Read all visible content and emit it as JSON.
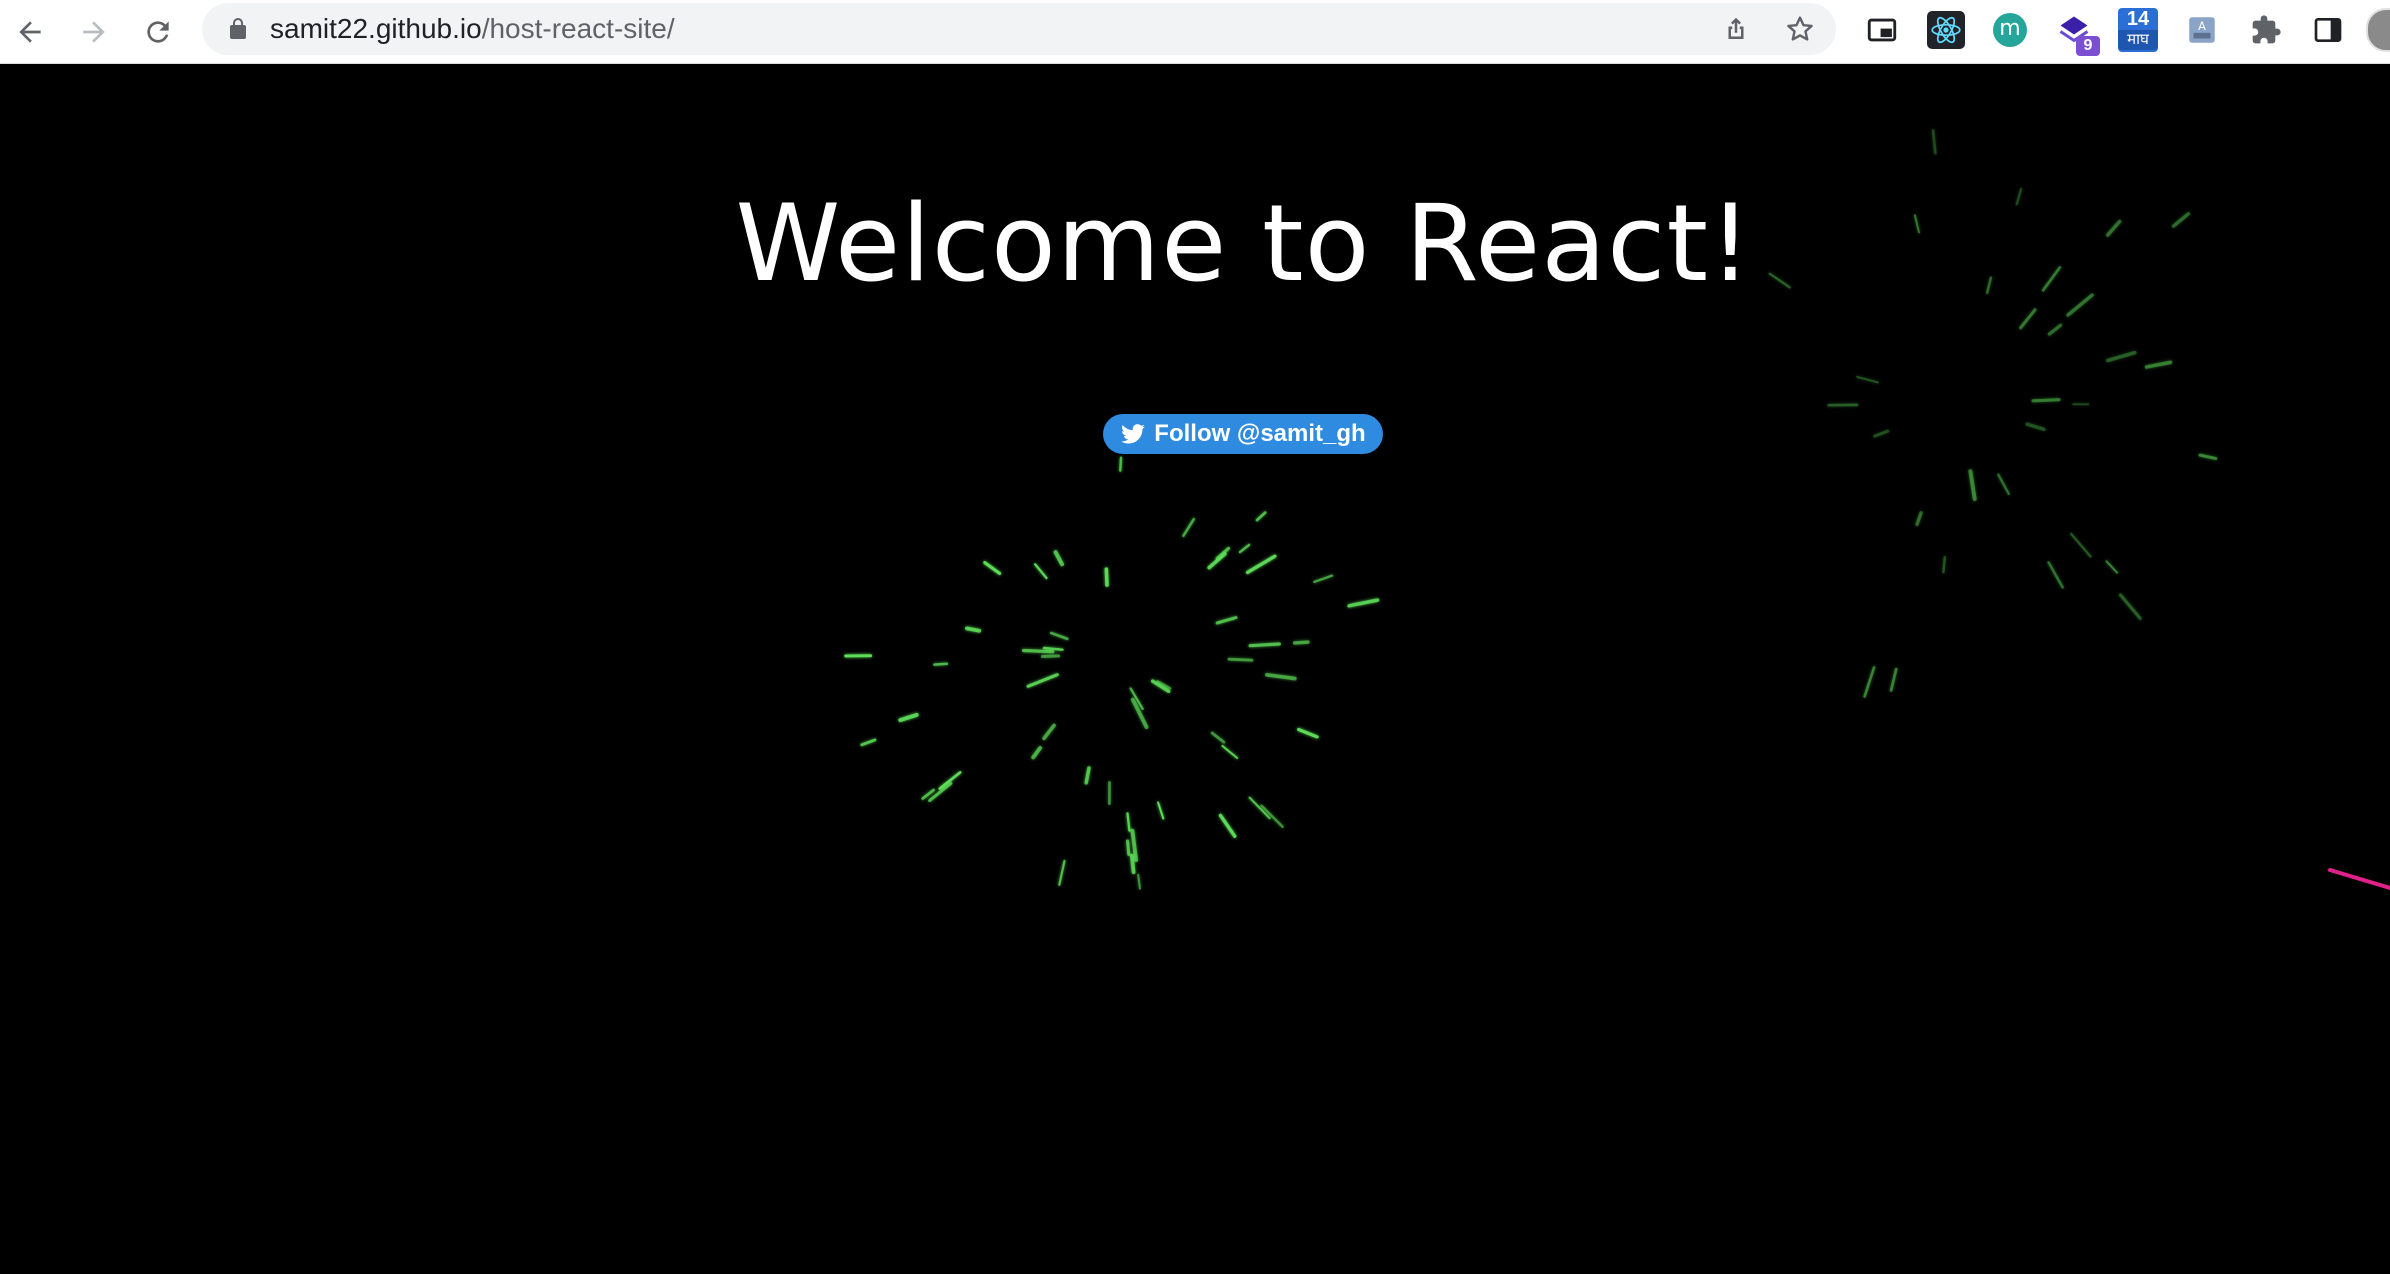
{
  "browser": {
    "url_host": "samit22.github.io",
    "url_path": "/host-react-site/",
    "extensions": {
      "badge_count": "9",
      "calendar_day": "14",
      "calendar_month": "माघ",
      "profile_letter": "m"
    },
    "icons": [
      "back-arrow-icon",
      "forward-arrow-icon",
      "reload-icon",
      "lock-icon",
      "share-icon",
      "star-icon",
      "picture-in-picture-icon",
      "react-icon",
      "puzzle-icon",
      "side-panel-icon"
    ]
  },
  "page": {
    "heading": "Welcome to React!",
    "follow_label": "Follow @samit_gh",
    "background_color": "#000000",
    "button_color": "#2f8be0",
    "spark_color": "#5fe05a",
    "streak_color": "#e0218a"
  }
}
